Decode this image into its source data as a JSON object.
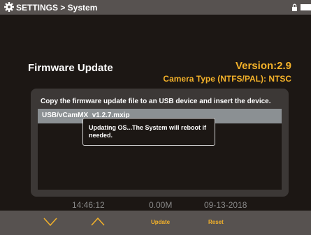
{
  "header": {
    "title": "SETTINGS > System",
    "icons": [
      "gear-icon",
      "lock-icon",
      "battery-icon"
    ]
  },
  "firmware": {
    "title": "Firmware Update",
    "version": "Version:2.9",
    "camera_type": "Camera Type (NTFS/PAL): NTSC",
    "instruction": "Copy the firmware update file to an USB device and insert the device.",
    "selected_file": "USB/vCamMX_v1.2.7.mxip"
  },
  "dialog": {
    "line1": "Updating OS...The System will reboot if",
    "line2": "needed."
  },
  "status": {
    "time": "14:46:12",
    "size": "0.00M",
    "date": "09-13-2018"
  },
  "footer": {
    "down_icon": "chevron-down-icon",
    "up_icon": "chevron-up-icon",
    "update_label": "Update",
    "reset_label": "Reset"
  },
  "colors": {
    "accent": "#f4b22a",
    "bar": "#575250",
    "background": "#1c1714",
    "panel": "#3c3836",
    "selection": "#8b9093"
  }
}
